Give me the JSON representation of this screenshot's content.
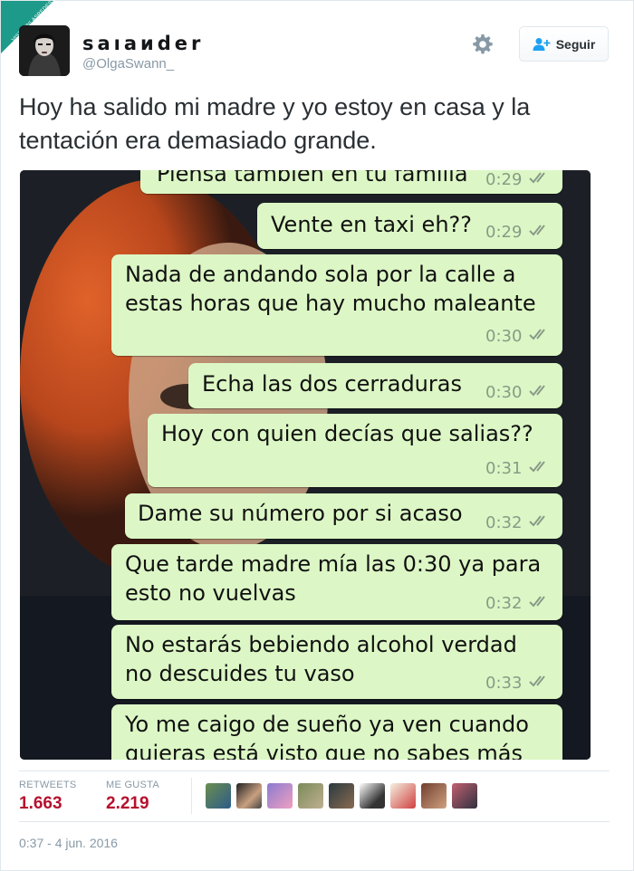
{
  "watermark": "VISTOENLASREDES.COM",
  "user": {
    "display_name": "saıaиder",
    "handle": "@OlgaSwann_",
    "follow_label": "Seguir"
  },
  "icons": {
    "settings": "gear-icon",
    "follow": "person-add-icon",
    "read_receipt": "double-check-icon"
  },
  "tweet": {
    "text": "Hoy ha salido mi madre y yo estoy en casa y la tentación era demasiado grande."
  },
  "chat": {
    "messages": [
      {
        "text": "Piensa también en tu familia",
        "time": "0:29"
      },
      {
        "text": "Vente en taxi eh??",
        "time": "0:29"
      },
      {
        "text": "Nada de andando sola por la calle a\nestas horas que hay mucho maleante",
        "time": "0:30"
      },
      {
        "text": "Echa las dos cerraduras",
        "time": "0:30"
      },
      {
        "text": "Hoy con quien decías que salias??",
        "time": "0:31"
      },
      {
        "text": "Dame su número por si acaso",
        "time": "0:32"
      },
      {
        "text": "Que tarde madre mía las 0:30 ya para\nesto no vuelvas",
        "time": "0:32"
      },
      {
        "text": "No estarás bebiendo alcohol verdad\nno descuides tu vaso",
        "time": "0:33"
      },
      {
        "text": "Yo me caigo de sueño ya ven cuando\nquieras está visto que no sabes más",
        "time": ""
      }
    ]
  },
  "stats": {
    "retweets_label": "RETWEETS",
    "retweets_value": "1.663",
    "likes_label": "ME GUSTA",
    "likes_value": "2.219"
  },
  "timestamp": "0:37 - 4 jun. 2016",
  "colors": {
    "bubble": "#dcf7c5",
    "stat_value": "#b5112e",
    "watermark": "#1d9a8a"
  }
}
